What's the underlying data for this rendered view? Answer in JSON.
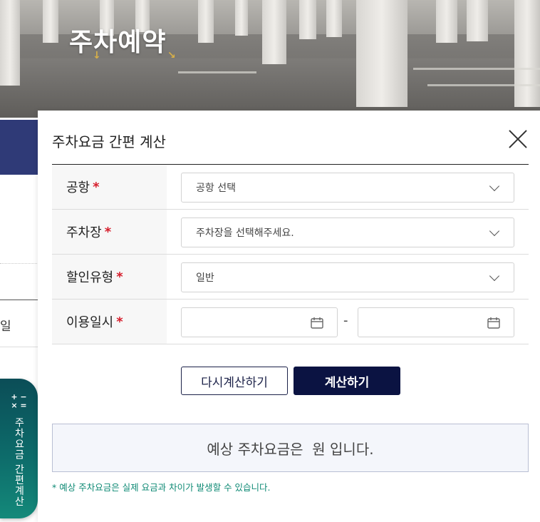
{
  "hero": {
    "title": "주차예약"
  },
  "underlying": {
    "partial_text": "일"
  },
  "side_button": {
    "icon": "calculator-icon",
    "symbols": [
      "+",
      "−",
      "×",
      "="
    ],
    "label": "주차요금 간편계산"
  },
  "modal": {
    "title": "주차요금 간편 계산",
    "close_icon": "close-icon",
    "required_mark": "*",
    "fields": [
      {
        "label": "공항",
        "value": "공항 선택"
      },
      {
        "label": "주차장",
        "value": "주차장을 선택해주세요."
      },
      {
        "label": "할인유형",
        "value": "일반"
      },
      {
        "label": "이용일시",
        "start_value": "",
        "end_value": "",
        "separator": "-"
      }
    ],
    "buttons": {
      "reset": "다시계산하기",
      "calculate": "계산하기"
    },
    "result": "예상 주차요금은  원 입니다.",
    "note": "* 예상 주차요금은 실제 요금과 차이가 발생할 수 있습니다."
  },
  "colors": {
    "navy": "#0b1342",
    "teal": "#0d6b6a",
    "required": "#d61e2c",
    "note": "#0f8a75"
  }
}
